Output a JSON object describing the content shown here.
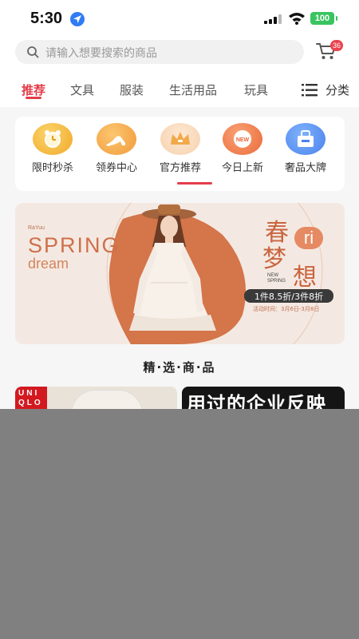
{
  "status_bar": {
    "time": "5:30",
    "battery": "100"
  },
  "search": {
    "placeholder": "请输入想要搜索的商品"
  },
  "cart": {
    "badge_count": "36"
  },
  "tabs": [
    {
      "label": "推荐",
      "active": true
    },
    {
      "label": "文具"
    },
    {
      "label": "服装"
    },
    {
      "label": "生活用品"
    },
    {
      "label": "玩具"
    }
  ],
  "category_button": {
    "label": "分类"
  },
  "quick_links": [
    {
      "label": "限时秒杀",
      "icon": "alarm-clock-icon"
    },
    {
      "label": "领券中心",
      "icon": "high-heel-icon"
    },
    {
      "label": "官方推荐",
      "icon": "crown-icon"
    },
    {
      "label": "今日上新",
      "icon": "new-badge-icon"
    },
    {
      "label": "奢品大牌",
      "icon": "gift-bag-icon"
    }
  ],
  "banner": {
    "brand_small": "RaYuu",
    "title_en": "SPRING",
    "subtitle_en": "dream",
    "title_cn_1": "春",
    "title_cn_2": "梦",
    "title_cn_3": "想",
    "ri": "ri",
    "new_label": "NEW",
    "spring_label": "SPRING",
    "discount": "1件8.5折/3件8折",
    "date": "活动时间：3月6日-3月8日"
  },
  "section_title": "精·选·商·品",
  "products": [
    {
      "brand_line1": "UNI",
      "brand_line2": "QLO"
    },
    {
      "title": "用过的企业反映"
    }
  ],
  "colors": {
    "accent": "#e43d4a",
    "banner_orange": "#d4754a",
    "background": "#f6f6f6"
  }
}
